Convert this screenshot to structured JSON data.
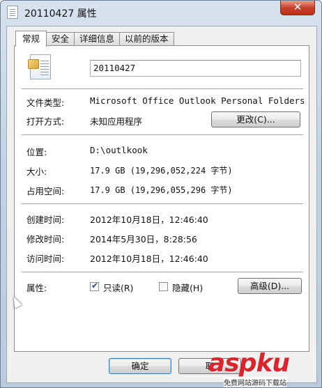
{
  "window": {
    "title": "20110427 属性",
    "close_glyph": "✕"
  },
  "tabs": [
    {
      "label": "常规",
      "active": true
    },
    {
      "label": "安全",
      "active": false
    },
    {
      "label": "详细信息",
      "active": false
    },
    {
      "label": "以前的版本",
      "active": false
    }
  ],
  "file": {
    "name": "20110427",
    "icon": "outlook-data-file-icon"
  },
  "fields": {
    "type_label": "文件类型:",
    "type_value": "Microsoft Office Outlook Personal Folders",
    "open_with_label": "打开方式:",
    "open_with_value": "未知应用程序",
    "change_button": "更改(C)...",
    "location_label": "位置:",
    "location_value": "D:\\outlkook",
    "size_label": "大小:",
    "size_value": "17.9 GB (19,296,052,224 字节)",
    "disk_size_label": "占用空间:",
    "disk_size_value": "17.9 GB (19,296,055,296 字节)",
    "created_label": "创建时间:",
    "created_value": "2012年10月18日，12:46:40",
    "modified_label": "修改时间:",
    "modified_value": "2014年5月30日，8:28:56",
    "accessed_label": "访问时间:",
    "accessed_value": "2012年10月18日，12:46:40",
    "attributes_label": "属性:",
    "readonly_label": "只读(R)",
    "readonly_checked": true,
    "hidden_label": "隐藏(H)",
    "hidden_checked": false,
    "advanced_button": "高级(D)..."
  },
  "footer": {
    "ok_button": "确定",
    "cancel_button": "取"
  },
  "watermark": {
    "text": "aspku",
    "subtext": "免费网站源码下载站"
  }
}
